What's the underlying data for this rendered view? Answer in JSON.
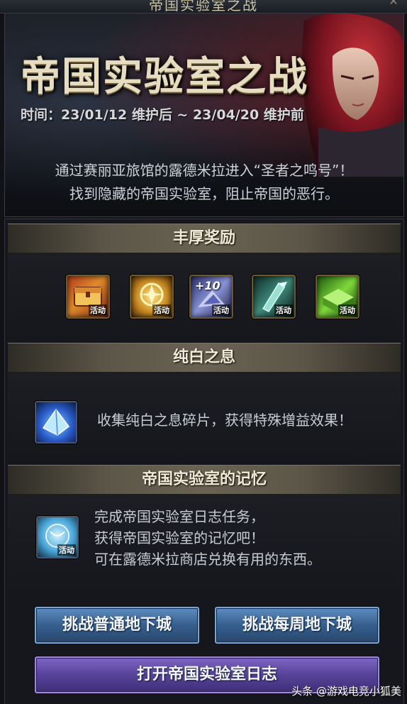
{
  "window": {
    "title": "帝国实验室之战",
    "close_symbol": "✕"
  },
  "banner": {
    "title": "帝国实验室之战",
    "period": "时间：23/01/12 维护后 ~ 23/04/20 维护前",
    "desc_line1": "通过赛丽亚旅馆的露德米拉进入“圣者之鸣号”！",
    "desc_line2": "找到隐藏的帝国实验室，阻止帝国的恶行。"
  },
  "rewards": {
    "header": "丰厚奖励",
    "items": [
      {
        "icon": "chest-box-icon",
        "tag": "活动"
      },
      {
        "icon": "gold-orb-icon",
        "tag": "活动"
      },
      {
        "icon": "reinforce-ticket-icon",
        "tag": "活动",
        "plus": "+10"
      },
      {
        "icon": "crystal-spear-icon",
        "tag": "活动"
      },
      {
        "icon": "green-box-icon",
        "tag": "活动"
      }
    ]
  },
  "pure_breath": {
    "header": "纯白之息",
    "icon": "white-crystal-icon",
    "text": "收集纯白之息碎片，获得特殊增益效果！"
  },
  "memory": {
    "header": "帝国实验室的记忆",
    "icon": "memory-orb-icon",
    "tag": "活动",
    "line1": "完成帝国实验室日志任务，",
    "line2": "获得帝国实验室的记忆吧！",
    "line3": "可在露德米拉商店兑换有用的东西。"
  },
  "buttons": {
    "normal_dungeon": "挑战普通地下城",
    "weekly_dungeon": "挑战每周地下城",
    "open_log": "打开帝国实验室日志"
  },
  "watermark": "头条 @游戏电竞小狐美",
  "colors": {
    "gold_frame": "#6e5a2a",
    "header_band": "#6a6353",
    "button_blue": "#365f8e",
    "button_purple": "#57439a"
  }
}
